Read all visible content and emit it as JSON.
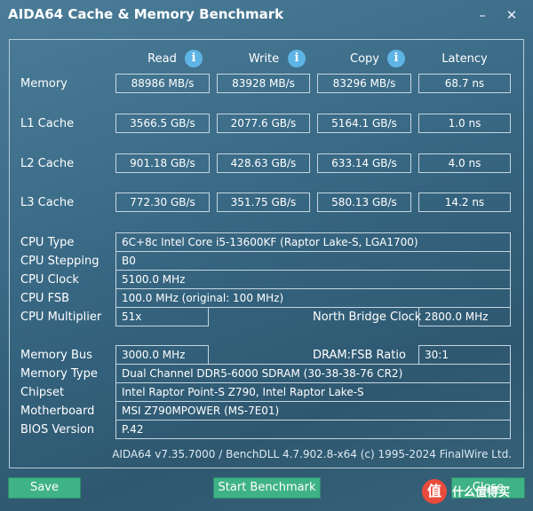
{
  "window": {
    "title": "AIDA64 Cache & Memory Benchmark",
    "minimize": "–",
    "close": "✕"
  },
  "columns": [
    "Read",
    "Write",
    "Copy",
    "Latency"
  ],
  "info_glyph": "i",
  "bench": [
    {
      "label": "Memory",
      "read": "88986 MB/s",
      "write": "83928 MB/s",
      "copy": "83296 MB/s",
      "latency": "68.7 ns"
    },
    {
      "label": "L1 Cache",
      "read": "3566.5 GB/s",
      "write": "2077.6 GB/s",
      "copy": "5164.1 GB/s",
      "latency": "1.0 ns"
    },
    {
      "label": "L2 Cache",
      "read": "901.18 GB/s",
      "write": "428.63 GB/s",
      "copy": "633.14 GB/s",
      "latency": "4.0 ns"
    },
    {
      "label": "L3 Cache",
      "read": "772.30 GB/s",
      "write": "351.75 GB/s",
      "copy": "580.13 GB/s",
      "latency": "14.2 ns"
    }
  ],
  "cpu": {
    "type_label": "CPU Type",
    "type": "6C+8c Intel Core i5-13600KF  (Raptor Lake-S, LGA1700)",
    "stepping_label": "CPU Stepping",
    "stepping": "B0",
    "clock_label": "CPU Clock",
    "clock": "5100.0 MHz",
    "fsb_label": "CPU FSB",
    "fsb": "100.0 MHz  (original: 100 MHz)",
    "multiplier_label": "CPU Multiplier",
    "multiplier": "51x",
    "nb_clock_label": "North Bridge Clock",
    "nb_clock": "2800.0 MHz"
  },
  "memory": {
    "bus_label": "Memory Bus",
    "bus": "3000.0 MHz",
    "ratio_label": "DRAM:FSB Ratio",
    "ratio": "30:1",
    "type_label": "Memory Type",
    "type": "Dual Channel DDR5-6000 SDRAM  (30-38-38-76 CR2)",
    "chipset_label": "Chipset",
    "chipset": "Intel Raptor Point-S Z790, Intel Raptor Lake-S",
    "motherboard_label": "Motherboard",
    "motherboard": "MSI Z790MPOWER (MS-7E01)",
    "bios_label": "BIOS Version",
    "bios": "P.42"
  },
  "footer": "AIDA64 v7.35.7000 / BenchDLL 4.7.902.8-x64  (c) 1995-2024 FinalWire Ltd.",
  "buttons": {
    "save": "Save",
    "start": "Start Benchmark",
    "close": "Close"
  },
  "watermark": {
    "glyph": "值",
    "text": "什么值得买"
  }
}
